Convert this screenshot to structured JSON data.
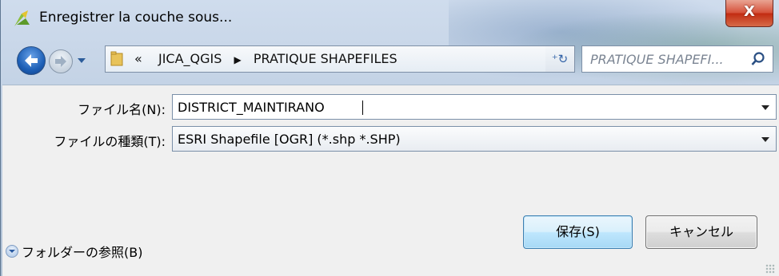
{
  "window": {
    "title": "Enregistrer la couche sous...",
    "close_label": "X"
  },
  "icons": {
    "app": "qgis-icon",
    "back": "back-arrow-icon",
    "forward": "forward-arrow-icon",
    "folder": "folder-icon",
    "refresh": "refresh-icon",
    "search": "search-icon",
    "browse": "expand-icon"
  },
  "navbar": {
    "breadcrumb_prefix": "«",
    "breadcrumb": [
      "JICA_QGIS",
      "PRATIQUE SHAPEFILES"
    ],
    "breadcrumb_sep": "▶",
    "refresh_glyph": "⁺↻",
    "search_placeholder": "PRATIQUE SHAPEFI..."
  },
  "form": {
    "filename_label": "ファイル名(N):",
    "filename_value": "DISTRICT_MAINTIRANO",
    "filetype_label": "ファイルの種類(T):",
    "filetype_value": "ESRI Shapefile [OGR] (*.shp *.SHP)"
  },
  "footer": {
    "browse_label": "フォルダーの参照(B)",
    "save_label": "保存(S)",
    "cancel_label": "キャンセル"
  },
  "colors": {
    "close": "#c22c12",
    "accent": "#1d5fb6",
    "save_button": "#bee6fd"
  }
}
